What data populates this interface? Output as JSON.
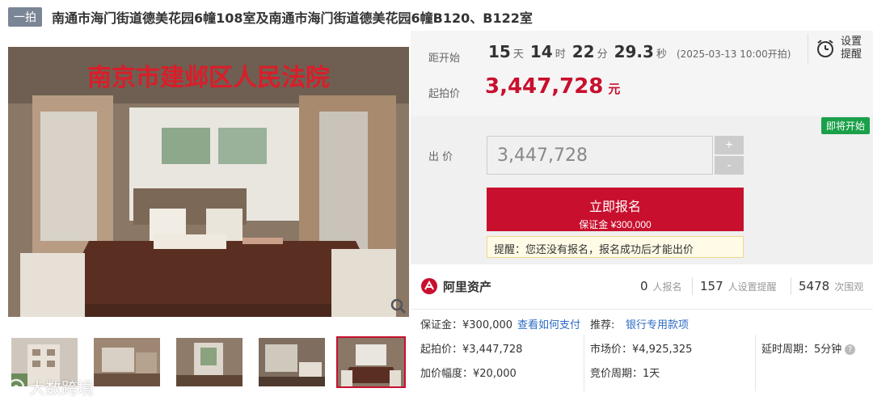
{
  "header": {
    "round_tag": "一拍",
    "title": "南通市海门街道德美花园6幢108室及南通市海门街道德美花园6幢B120、B122室"
  },
  "gallery": {
    "main_overlay_text": "南京市建邺区人民法院",
    "zoom_icon": "magnifier-icon",
    "thumbnail_count": 5,
    "active_thumbnail": 5,
    "watermark_text": "大数跨境"
  },
  "countdown": {
    "label": "距开始",
    "days": "15",
    "days_unit": "天",
    "hours": "14",
    "hours_unit": "时",
    "minutes": "22",
    "minutes_unit": "分",
    "seconds": "29.3",
    "seconds_unit": "秒",
    "start_note": "(2025-03-13 10:00开拍)"
  },
  "reminder": {
    "label": "设置提醒",
    "icon": "alarm-clock-icon"
  },
  "starting_price": {
    "label": "起拍价",
    "value": "3,447,728",
    "unit": "元"
  },
  "bid": {
    "badge": "即将开始",
    "label": "出 价",
    "input_value": "3,447,728",
    "plus": "+",
    "minus": "-",
    "register_main": "立即报名",
    "register_sub": "保证金 ¥300,000",
    "tip": "提醒：您还没有报名，报名成功后才能出价"
  },
  "stats": {
    "brand": "阿里资产",
    "brand_icon": "ali-assets-logo-icon",
    "applicants_num": "0",
    "applicants_label": "人报名",
    "reminders_num": "157",
    "reminders_label": "人设置提醒",
    "views_num": "5478",
    "views_label": "次围观"
  },
  "details": {
    "deposit": "保证金：¥300,000",
    "how_to_pay": "查看如何支付",
    "recommend_label": "推荐:",
    "recommend_link": "银行专用款项",
    "start_price": "起拍价：¥3,447,728",
    "market_price": "市场价：¥4,925,325",
    "delay_period": "延时周期：5分钟",
    "increment": "加价幅度：¥20,000",
    "bid_period": "竞价周期：1天"
  },
  "colors": {
    "accent_red": "#c8102e",
    "badge_green": "#1aa04a",
    "link_blue": "#2d6bc4",
    "round_tag_gray": "#7a8596"
  }
}
